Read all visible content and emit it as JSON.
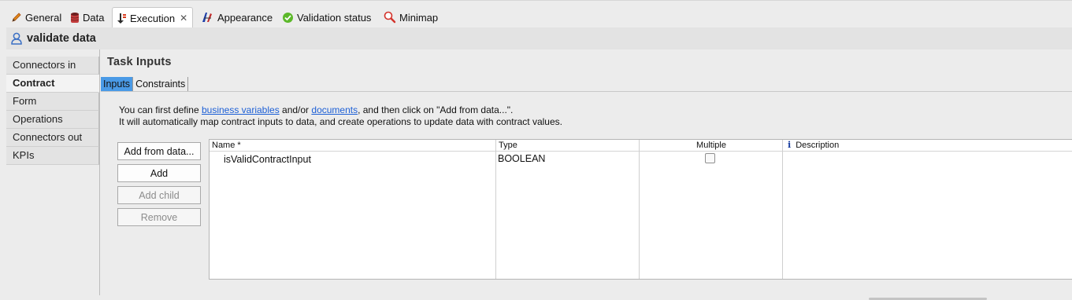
{
  "tabs": [
    {
      "label": "General",
      "icon": "pencil-icon"
    },
    {
      "label": "Data",
      "icon": "database-icon"
    },
    {
      "label": "Execution",
      "icon": "execution-icon",
      "active": true,
      "close": "✕"
    },
    {
      "label": "Appearance",
      "icon": "appearance-icon"
    },
    {
      "label": "Validation status",
      "icon": "check-icon"
    },
    {
      "label": "Minimap",
      "icon": "magnifier-icon"
    }
  ],
  "title": "validate data",
  "nav": [
    "Connectors in",
    "Contract",
    "Form",
    "Operations",
    "Connectors out",
    "KPIs"
  ],
  "nav_selected": "Contract",
  "section_title": "Task Inputs",
  "subtabs": [
    "Inputs",
    "Constraints"
  ],
  "info": {
    "line1_a": "You can first define ",
    "link1": "business variables",
    "line1_b": " and/or ",
    "link2": "documents",
    "line1_c": ", and then click on \"Add from data...\".",
    "line2": "It will automatically map contract inputs to data, and create operations to update data with contract values."
  },
  "buttons": {
    "add_from_data": "Add from data...",
    "add": "Add",
    "add_child": "Add child",
    "remove": "Remove"
  },
  "table": {
    "headers": {
      "name": "Name *",
      "type": "Type",
      "multiple": "Multiple",
      "description": "Description"
    },
    "rows": [
      {
        "name": "isValidContractInput",
        "type": "BOOLEAN",
        "multiple": false,
        "description": ""
      }
    ]
  },
  "colors": {
    "active_subtab": "#4a9ae6",
    "link": "#1c5fd6"
  }
}
